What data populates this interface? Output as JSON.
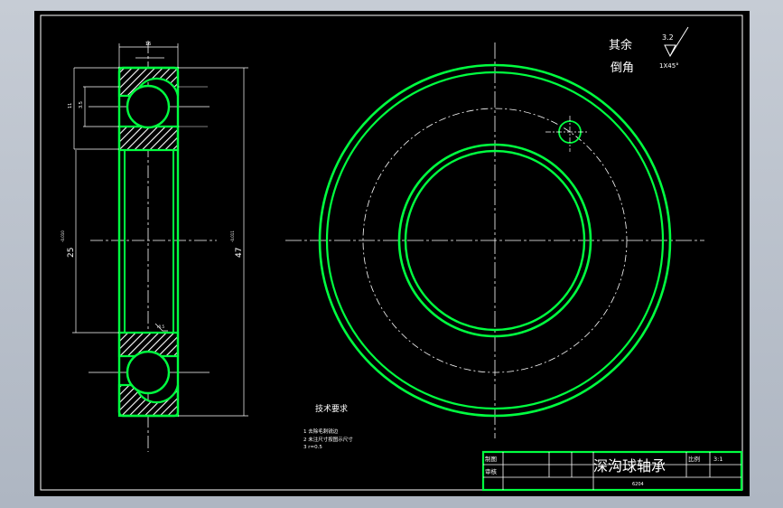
{
  "notes": {
    "other": "其余",
    "chamfer": "倒角",
    "roughness": "3.2",
    "chamfer_spec": "1X45°"
  },
  "dimensions": {
    "width_top": "16",
    "left_outer_a": "11",
    "left_outer_b": "3.5",
    "inner_dia": "25",
    "inner_tol": "-0.010",
    "outer_dia": "47",
    "outer_tol": "-0.011",
    "radius_mark": "r0.5"
  },
  "tech": {
    "heading": "技术要求",
    "items": [
      "1  去除毛刺锐边",
      "2  未注尺寸按图示尺寸",
      "3  r=0.5"
    ]
  },
  "title_block": {
    "drawing_label": "制图",
    "review_label": "审核",
    "part_name": "深沟球轴承",
    "scale_label": "比例",
    "scale_value": "3:1",
    "code": "6204"
  },
  "colors": {
    "background": "#000000",
    "outline": "#00ff40",
    "line": "#ffffff",
    "window": "#c3c9d2"
  }
}
